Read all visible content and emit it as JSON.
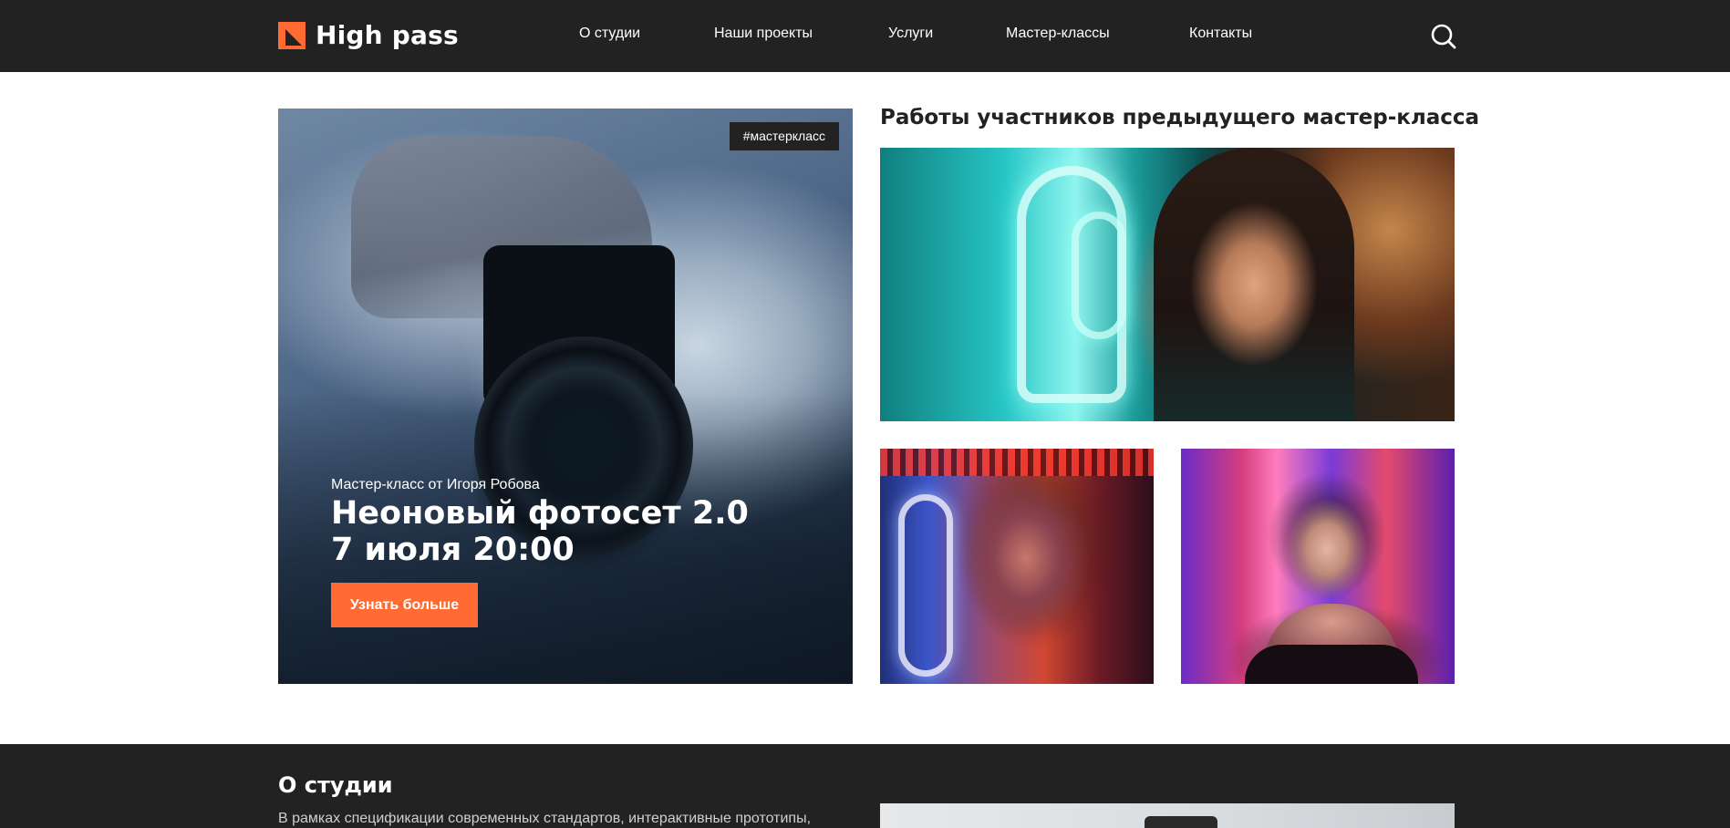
{
  "header": {
    "logo_text": "High pass",
    "nav": [
      {
        "label": "О студии"
      },
      {
        "label": "Наши проекты"
      },
      {
        "label": "Услуги"
      },
      {
        "label": "Мастер-классы"
      },
      {
        "label": "Контакты"
      }
    ],
    "search_icon": "search-icon"
  },
  "hero": {
    "tag": "#мастеркласс",
    "subtitle": "Мастер-класс от Игоря Робова",
    "title_line1": "Неоновый фотосет 2.0",
    "title_line2": "7 июля 20:00",
    "button_label": "Узнать больше"
  },
  "works": {
    "title": "Работы участников предыдущего мастер-класса"
  },
  "about": {
    "title": "О студии",
    "text": "В рамках спецификации современных стандартов, интерактивные прототипы,"
  },
  "colors": {
    "dark": "#222222",
    "accent": "#ff6b32",
    "white": "#ffffff"
  }
}
